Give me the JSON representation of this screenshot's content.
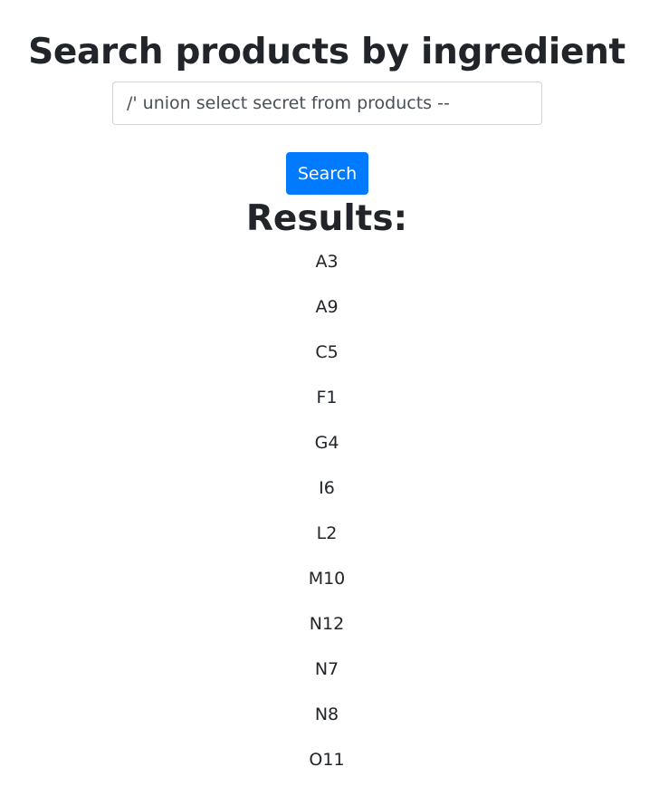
{
  "page": {
    "title": "Search products by ingredient"
  },
  "search": {
    "value": "/' union select secret from products --",
    "button_label": "Search"
  },
  "results": {
    "heading": "Results:",
    "items": [
      "A3",
      "A9",
      "C5",
      "F1",
      "G4",
      "I6",
      "L2",
      "M10",
      "N12",
      "N7",
      "N8",
      "O11"
    ]
  },
  "colors": {
    "primary": "#007bff",
    "text": "#212529",
    "input_border": "#ced4da"
  }
}
